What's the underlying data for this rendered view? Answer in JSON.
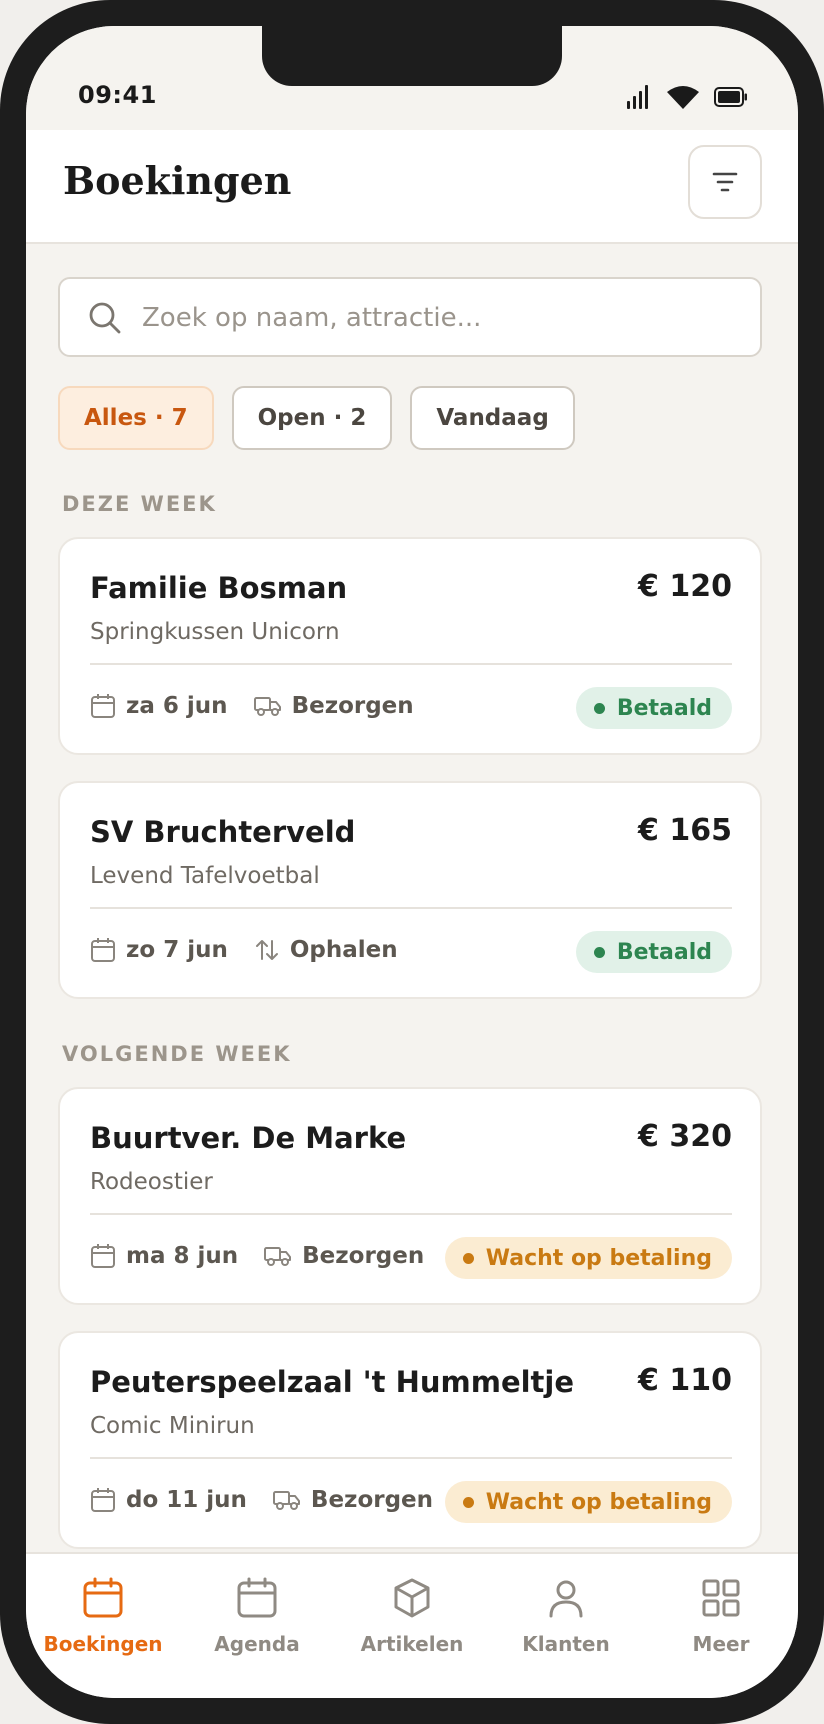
{
  "status": {
    "time": "09:41"
  },
  "header": {
    "title": "Boekingen"
  },
  "search": {
    "placeholder": "Zoek op naam, attractie..."
  },
  "filters": [
    {
      "label": "Alles · 7",
      "active": true
    },
    {
      "label": "Open · 2",
      "active": false
    },
    {
      "label": "Vandaag",
      "active": false
    }
  ],
  "sections": {
    "this_week": "DEZE WEEK",
    "next_week": "VOLGENDE WEEK"
  },
  "bookings": [
    {
      "name": "Familie Bosman",
      "item": "Springkussen Unicorn",
      "price": "€ 120",
      "date": "za 6 jun",
      "method": "Bezorgen",
      "method_icon": "truck-icon",
      "status": "Betaald",
      "status_type": "paid"
    },
    {
      "name": "SV Bruchterveld",
      "item": "Levend Tafelvoetbal",
      "price": "€ 165",
      "date": "zo 7 jun",
      "method": "Ophalen",
      "method_icon": "pickup-arrows-icon",
      "status": "Betaald",
      "status_type": "paid"
    },
    {
      "name": "Buurtver. De Marke",
      "item": "Rodeostier",
      "price": "€ 320",
      "date": "ma 8 jun",
      "method": "Bezorgen",
      "method_icon": "truck-icon",
      "status": "Wacht op betaling",
      "status_type": "wait"
    },
    {
      "name": "Peuterspeelzaal 't Hummeltje",
      "item": "Comic Minirun",
      "price": "€ 110",
      "date": "do 11 jun",
      "method": "Bezorgen",
      "method_icon": "truck-icon",
      "status": "Wacht op betaling",
      "status_type": "wait"
    }
  ],
  "tabbar": [
    {
      "label": "Boekingen",
      "icon": "calendar-icon",
      "active": true
    },
    {
      "label": "Agenda",
      "icon": "calendar-icon",
      "active": false
    },
    {
      "label": "Artikelen",
      "icon": "box-icon",
      "active": false
    },
    {
      "label": "Klanten",
      "icon": "user-icon",
      "active": false
    },
    {
      "label": "Meer",
      "icon": "grid-icon",
      "active": false
    }
  ],
  "colors": {
    "accent": "#e66a12",
    "paid": "#2d8550",
    "waiting": "#c97a12"
  }
}
